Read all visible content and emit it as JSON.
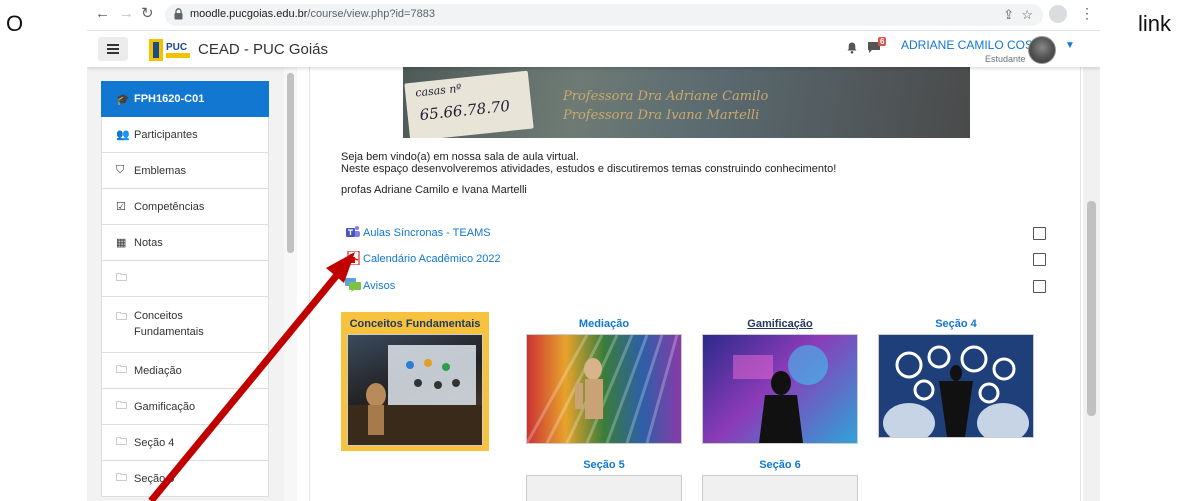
{
  "doc": {
    "word_left": "O",
    "word_right": "link"
  },
  "browser": {
    "url_host": "moodle.pucgoias.edu.br",
    "url_path": "/course/view.php?id=7883"
  },
  "header": {
    "logo_text": "PUC",
    "site_name": "CEAD - PUC Goiás",
    "message_count": "6",
    "user_name": "ADRIANE CAMILO COSTA",
    "user_role": "Estudante"
  },
  "drawer": {
    "items": [
      {
        "label": "FPH1620-C01",
        "icon": "graduation-cap-icon"
      },
      {
        "label": "Participantes",
        "icon": "users-icon"
      },
      {
        "label": "Emblemas",
        "icon": "shield-icon"
      },
      {
        "label": "Competências",
        "icon": "checkbox-icon"
      },
      {
        "label": "Notas",
        "icon": "table-icon"
      },
      {
        "label": "",
        "icon": "folder-icon"
      },
      {
        "label": "Conceitos Fundamentais",
        "icon": "folder-icon"
      },
      {
        "label": "Mediação",
        "icon": "folder-icon"
      },
      {
        "label": "Gamificação",
        "icon": "folder-icon"
      },
      {
        "label": "Seção 4",
        "icon": "folder-icon"
      },
      {
        "label": "Seção 5",
        "icon": "folder-icon"
      }
    ]
  },
  "banner": {
    "card_line1": "casas nº",
    "card_line2": "65.66.78.70",
    "line1": "Professora Dra Adriane Camilo",
    "line2": "Professora Dra Ivana Martelli"
  },
  "summary": {
    "line1": "Seja bem vindo(a) em nossa sala de aula virtual.",
    "line2": "Neste espaço desenvolveremos atividades, estudos e discutiremos temas construindo conhecimento!",
    "signature": "profas Adriane Camilo e  Ivana Martelli"
  },
  "activities": [
    {
      "label": "Aulas Síncronas - TEAMS",
      "icon": "teams-icon"
    },
    {
      "label": "Calendário Acadêmico 2022",
      "icon": "pdf-icon"
    },
    {
      "label": "Avisos",
      "icon": "forum-icon"
    }
  ],
  "tiles": [
    {
      "title": "Conceitos Fundamentais"
    },
    {
      "title": "Mediação"
    },
    {
      "title": "Gamificação"
    },
    {
      "title": "Seção 4"
    },
    {
      "title": "Seção 5"
    },
    {
      "title": "Seção 6"
    }
  ],
  "colors": {
    "accent": "#1177d1",
    "current_section": "#f7c33e",
    "arrow": "#c00000"
  }
}
